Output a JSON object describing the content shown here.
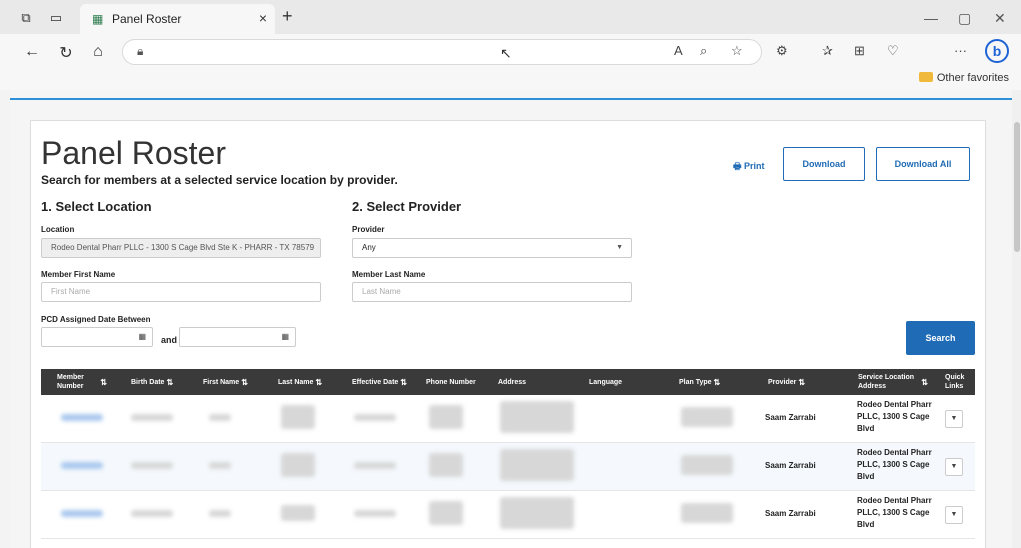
{
  "browser": {
    "tab_title": "Panel Roster",
    "tab_close": "×",
    "new_tab": "+",
    "favorites_folder": "Other favorites",
    "win_minimize": "—",
    "win_restore": "▢",
    "win_close": "✕",
    "more_menu": "···",
    "bing_label": "b"
  },
  "page": {
    "title": "Panel Roster",
    "subtitle": "Search for members at a selected service location by provider.",
    "print_label": "Print",
    "download_label": "Download",
    "download_all_label": "Download All",
    "section1": "1. Select Location",
    "section2": "2. Select Provider",
    "location_label": "Location",
    "location_value": "Rodeo Dental Pharr PLLC - 1300 S Cage Blvd Ste K - PHARR - TX 78579",
    "provider_label": "Provider",
    "provider_value": "Any",
    "first_name_label": "Member First Name",
    "first_name_placeholder": "First Name",
    "last_name_label": "Member Last Name",
    "last_name_placeholder": "Last Name",
    "pcd_label": "PCD Assigned Date Between",
    "and_label": "and",
    "search_label": "Search"
  },
  "table": {
    "headers": {
      "member_number": "Member Number",
      "birth_date": "Birth Date",
      "first_name": "First Name",
      "last_name": "Last Name",
      "effective_date": "Effective Date",
      "phone": "Phone Number",
      "address": "Address",
      "language": "Language",
      "plan_type": "Plan Type",
      "provider": "Provider",
      "service_location": "Service Location Address",
      "quick_links": "Quick Links"
    },
    "rows": [
      {
        "provider": "Saam Zarrabi",
        "location": "Rodeo Dental Pharr PLLC, 1300 S Cage Blvd"
      },
      {
        "provider": "Saam Zarrabi",
        "location": "Rodeo Dental Pharr PLLC, 1300 S Cage Blvd"
      },
      {
        "provider": "Saam Zarrabi",
        "location": "Rodeo Dental Pharr PLLC, 1300 S Cage Blvd"
      }
    ]
  },
  "colors": {
    "accent": "#1f6bb5",
    "table_header": "#3a3a3a",
    "page_topline": "#2d8fd5"
  },
  "icons": [
    "tab-actions-icon",
    "workspaces-icon",
    "back-icon",
    "refresh-icon",
    "home-icon",
    "lock-icon",
    "read-aloud-icon",
    "zoom-icon",
    "favorite-star-icon",
    "extensions-icon",
    "favorites-icon",
    "collections-icon",
    "performance-icon",
    "print-icon",
    "calendar-icon",
    "sort-icon",
    "dropdown-caret-icon"
  ]
}
